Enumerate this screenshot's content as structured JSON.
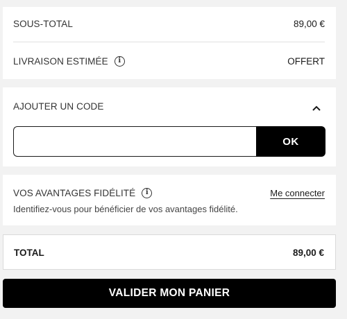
{
  "summary": {
    "subtotal_label": "SOUS-TOTAL",
    "subtotal_value": "89,00 €",
    "shipping_label": "LIVRAISON ESTIMÉE",
    "shipping_value": "OFFERT"
  },
  "promo": {
    "label": "AJOUTER UN CODE",
    "input_value": "",
    "input_placeholder": "",
    "submit_label": "OK",
    "chevron_icon": "chevron-up-icon"
  },
  "loyalty": {
    "label": "VOS AVANTAGES FIDÉLITÉ",
    "link_label": "Me connecter",
    "description": "Identifiez-vous pour bénéficier de vos avantages fidélité."
  },
  "total": {
    "label": "TOTAL",
    "value": "89,00 €"
  },
  "checkout": {
    "button_label": "VALIDER MON PANIER"
  },
  "icons": {
    "info": "info-icon"
  },
  "colors": {
    "background": "#f2f2f2",
    "card": "#ffffff",
    "primary": "#000000",
    "divider": "#e0e0e0"
  }
}
